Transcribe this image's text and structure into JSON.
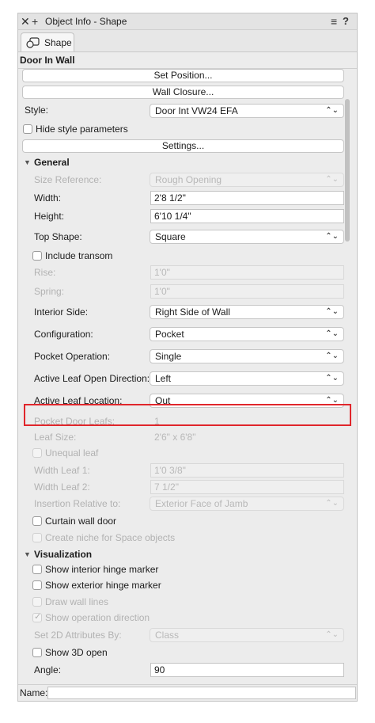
{
  "window": {
    "close_icon": "close-icon",
    "add_icon": "plus-icon",
    "title": "Object Info - Shape",
    "menu_icon": "hamburger-icon",
    "help_label": "?"
  },
  "tab": {
    "label": "Shape",
    "icon": "shape-icon"
  },
  "object_type": "Door In Wall",
  "buttons": {
    "set_position": "Set Position...",
    "wall_closure": "Wall Closure...",
    "settings": "Settings..."
  },
  "style": {
    "label": "Style:",
    "value": "Door Int VW24 EFA"
  },
  "hide_style": {
    "label": "Hide style parameters",
    "checked": false
  },
  "general": {
    "title": "General",
    "size_reference": {
      "label": "Size Reference:",
      "value": "Rough Opening"
    },
    "width": {
      "label": "Width:",
      "value": "2'8 1/2\""
    },
    "height": {
      "label": "Height:",
      "value": "6'10 1/4\""
    },
    "top_shape": {
      "label": "Top Shape:",
      "value": "Square"
    },
    "include_transom": {
      "label": "Include transom",
      "checked": false
    },
    "rise": {
      "label": "Rise:",
      "value": "1'0\""
    },
    "spring": {
      "label": "Spring:",
      "value": "1'0\""
    },
    "interior_side": {
      "label": "Interior Side:",
      "value": "Right Side of Wall"
    },
    "configuration": {
      "label": "Configuration:",
      "value": "Pocket"
    },
    "pocket_operation": {
      "label": "Pocket Operation:",
      "value": "Single"
    },
    "active_leaf_open_direction": {
      "label": "Active Leaf Open Direction:",
      "value": "Left"
    },
    "active_leaf_location": {
      "label": "Active Leaf Location:",
      "value": "Out"
    },
    "pocket_door_leafs": {
      "label": "Pocket Door Leafs:",
      "value": "1"
    },
    "leaf_size": {
      "label": "Leaf Size:",
      "value": "2'6\" x 6'8\""
    },
    "unequal_leaf": {
      "label": "Unequal leaf",
      "checked": false
    },
    "width_leaf_1": {
      "label": "Width Leaf 1:",
      "value": "1'0 3/8\""
    },
    "width_leaf_2": {
      "label": "Width Leaf 2:",
      "value": "7 1/2\""
    },
    "insertion_relative_to": {
      "label": "Insertion Relative to:",
      "value": "Exterior Face of Jamb"
    },
    "curtain_wall_door": {
      "label": "Curtain wall door",
      "checked": false
    },
    "create_niche": {
      "label": "Create niche for Space objects",
      "checked": false
    }
  },
  "visualization": {
    "title": "Visualization",
    "show_interior_hinge": {
      "label": "Show interior hinge marker",
      "checked": false
    },
    "show_exterior_hinge": {
      "label": "Show exterior hinge marker",
      "checked": false
    },
    "draw_wall_lines": {
      "label": "Draw wall lines",
      "checked": false
    },
    "show_operation_direction": {
      "label": "Show operation direction",
      "checked": true
    },
    "set_2d_attributes": {
      "label": "Set 2D Attributes By:",
      "value": "Class"
    },
    "show_3d_open": {
      "label": "Show 3D open",
      "checked": false
    },
    "angle": {
      "label": "Angle:",
      "value": "90"
    }
  },
  "name": {
    "label": "Name:",
    "value": ""
  },
  "colors": {
    "highlight": "#e0262b",
    "panel": "#ececec"
  }
}
